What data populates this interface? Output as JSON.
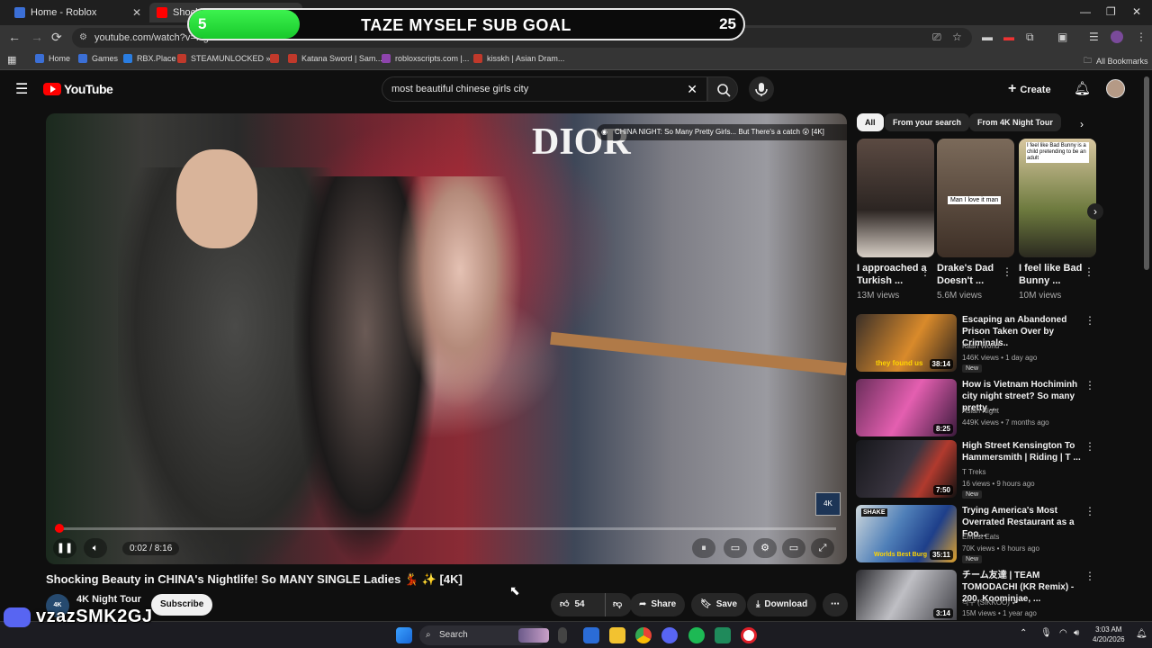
{
  "browser": {
    "tabs": [
      {
        "label": "Home - Roblox",
        "active": false
      },
      {
        "label": "Shockin",
        "active": true
      }
    ],
    "url": "youtube.com/watch?v=Rg",
    "bookmarks": [
      "Home",
      "Games",
      "RBX.Place",
      "STEAMUNLOCKED »...",
      "",
      "Katana Sword | Sam...",
      "robloxscripts.com |...",
      "kisskh | Asian Dram..."
    ],
    "all_bookmarks": "All Bookmarks"
  },
  "overlay": {
    "goal_title": "TAZE MYSELF SUB GOAL",
    "goal_current": "5",
    "goal_target": "25",
    "goal_progress": 0.2,
    "discord_tag": "vzazSMK2GJ"
  },
  "youtube": {
    "logo": "YouTube",
    "search_query": "most beautiful chinese girls city",
    "create_label": "Create"
  },
  "video": {
    "overlay_title": "CHINA NIGHT: So Many Pretty Girls... But There's a catch 😮 [4K]",
    "title": "Shocking Beauty in CHINA's Nightlife! So MANY SINGLE Ladies 💃 ✨ [4K]",
    "time_current": "0:02",
    "time_total": "8:16",
    "time_display": "0:02 / 8:16",
    "progress": 0.004,
    "badge": "4K",
    "channel": "4K Night Tour",
    "channel_avatar": "4K",
    "subscribe_label": "Subscribe",
    "likes": "54",
    "share_label": "Share",
    "save_label": "Save",
    "download_label": "Download"
  },
  "sidebar": {
    "chips": [
      "All",
      "From your search",
      "From 4K Night Tour"
    ],
    "shorts": [
      {
        "title": "I approached a Turkish ...",
        "views": "13M views",
        "caption": ""
      },
      {
        "title": "Drake's Dad Doesn't ...",
        "views": "5.6M views",
        "caption": "Man I love it man"
      },
      {
        "title": "I feel like Bad Bunny ...",
        "views": "10M views",
        "caption": "I feel like Bad Bunny is a child pretending to be an adult"
      }
    ],
    "recommendations": [
      {
        "title": "Escaping an Abandoned Prison Taken Over by Criminals..",
        "channel": "Kash World",
        "meta": "146K views • 1 day ago",
        "new": "New",
        "duration": "38:14",
        "thumb_caption": "they found us"
      },
      {
        "title": "How is Vietnam Hochiminh city night street? So many pretty ...",
        "channel": "Asian Night",
        "meta": "449K views • 7 months ago",
        "new": "",
        "duration": "8:25",
        "thumb_caption": ""
      },
      {
        "title": "High Street Kensington To Hammersmith | Riding | T ...",
        "channel": "T Treks",
        "meta": "16 views • 9 hours ago",
        "new": "New",
        "duration": "7:50",
        "thumb_caption": ""
      },
      {
        "title": "Trying America's Most Overrated Restaurant as a Foo...",
        "channel": "Ernest Eats",
        "meta": "70K views • 8 hours ago",
        "new": "New",
        "duration": "35:11",
        "thumb_caption": "Worlds Best Burg"
      },
      {
        "title": "チーム友達 | TEAM TOMODACHI (KR Remix) - 200, Koominjae, ...",
        "channel": "식구 (SIKKOO) ✔",
        "meta": "15M views • 1 year ago",
        "new": "",
        "duration": "3:14",
        "thumb_caption": ""
      }
    ]
  },
  "taskbar": {
    "search_placeholder": "Search",
    "time": "3:03 AM",
    "date": "4/20/2026"
  },
  "colors": {
    "yt_red": "#ff0000",
    "goal_green": "#2ee040",
    "background": "#0f0f0f"
  }
}
